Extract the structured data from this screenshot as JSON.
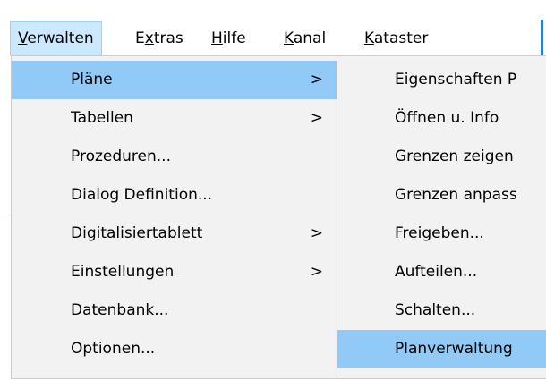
{
  "menubar": {
    "items": [
      {
        "label": "Verwalten",
        "mnemonic_index": 0
      },
      {
        "label": "Extras",
        "mnemonic_index": 1
      },
      {
        "label": "Hilfe",
        "mnemonic_index": 0
      },
      {
        "label": "Kanal",
        "mnemonic_index": 0
      },
      {
        "label": "Kataster",
        "mnemonic_index": 0
      }
    ],
    "active_index": 0
  },
  "main_menu": {
    "items": [
      {
        "label": "Pläne",
        "submenu": true,
        "highlighted": true
      },
      {
        "label": "Tabellen",
        "submenu": true
      },
      {
        "label": "Prozeduren...",
        "submenu": false
      },
      {
        "label": "Dialog Definition...",
        "submenu": false
      },
      {
        "label": "Digitalisiertablett",
        "submenu": true
      },
      {
        "label": "Einstellungen",
        "submenu": true
      },
      {
        "label": "Datenbank...",
        "submenu": false
      },
      {
        "label": "Optionen...",
        "submenu": false
      }
    ],
    "arrow_glyph": ">"
  },
  "sub_menu": {
    "items": [
      {
        "label": "Eigenschaften P"
      },
      {
        "label": "Öffnen u. Info"
      },
      {
        "label": "Grenzen zeigen"
      },
      {
        "label": "Grenzen anpass"
      },
      {
        "label": "Freigeben..."
      },
      {
        "label": "Aufteilen..."
      },
      {
        "label": "Schalten..."
      },
      {
        "label": "Planverwaltung",
        "highlighted": true
      }
    ]
  },
  "colors": {
    "menubar_active_bg": "#cce8ff",
    "menu_highlight": "#91c9f7",
    "menu_bg": "#f2f2f2"
  }
}
